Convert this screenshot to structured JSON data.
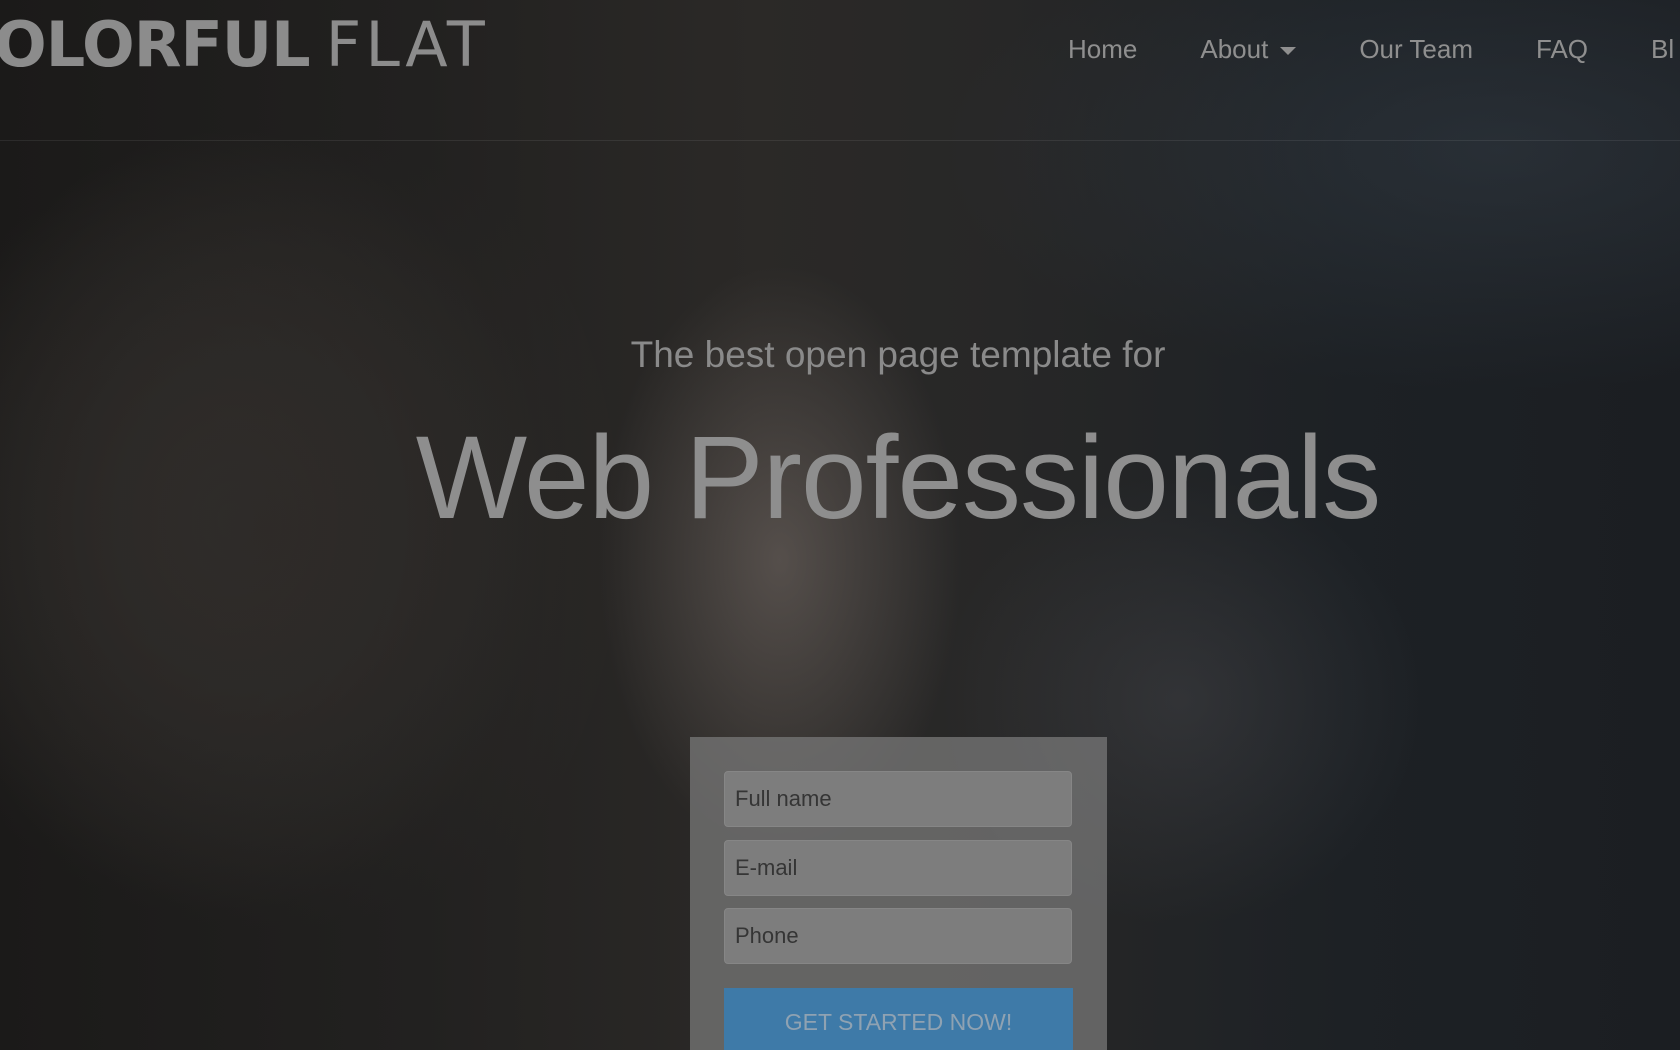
{
  "brand": {
    "bold": "OLORFUL",
    "light": "FLAT"
  },
  "nav": {
    "items": [
      {
        "label": "Home"
      },
      {
        "label": "About"
      },
      {
        "label": "Our Team"
      },
      {
        "label": "FAQ"
      },
      {
        "label": "Bl"
      }
    ]
  },
  "hero": {
    "subtitle": "The best open page template for",
    "title": "Web Professionals"
  },
  "form": {
    "full_name_placeholder": "Full name",
    "email_placeholder": "E-mail",
    "phone_placeholder": "Phone",
    "submit_label": "GET STARTED NOW!"
  },
  "colors": {
    "button": "#3e7aa8",
    "overlay": "#161718"
  }
}
